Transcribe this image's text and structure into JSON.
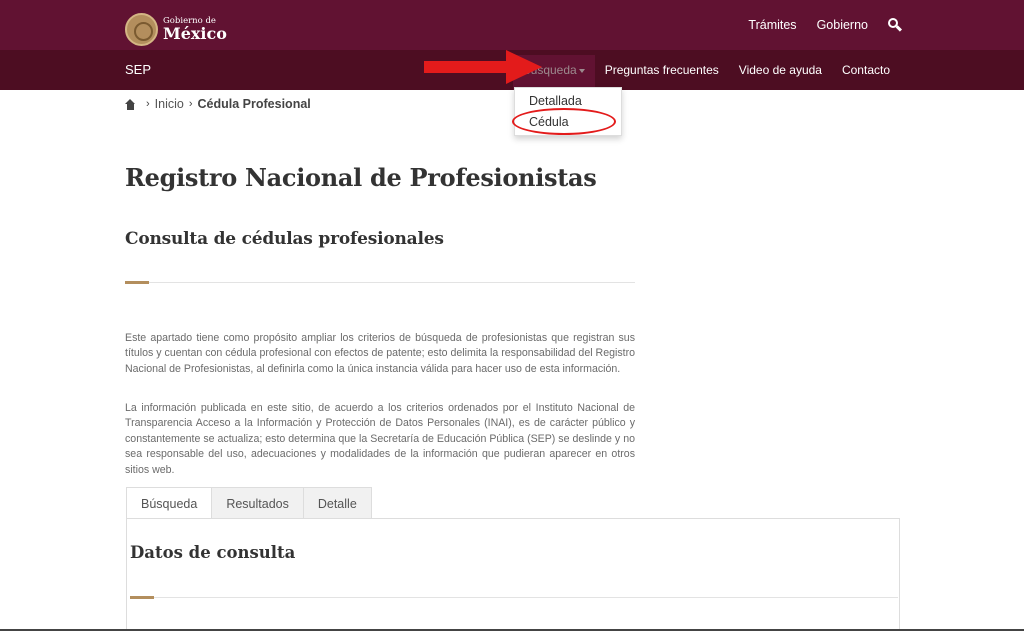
{
  "header": {
    "logo": {
      "line1": "Gobierno de",
      "line2": "México"
    },
    "links": [
      "Trámites",
      "Gobierno"
    ],
    "search_icon": "search-icon"
  },
  "nav": {
    "brand": "SEP",
    "items": [
      {
        "label": "Búsqueda"
      },
      {
        "label": "Preguntas frecuentes"
      },
      {
        "label": "Video de ayuda"
      },
      {
        "label": "Contacto"
      }
    ],
    "dropdown": [
      "Detallada",
      "Cédula"
    ]
  },
  "annotations": {
    "arrow_color": "#e31b1b",
    "circle_color": "#e31b1b"
  },
  "breadcrumb": {
    "home_icon": "home-icon",
    "inicio": "Inicio",
    "current": "Cédula Profesional"
  },
  "main": {
    "title": "Registro Nacional de Profesionistas",
    "subtitle": "Consulta de cédulas profesionales",
    "paragraphs": [
      "Este apartado tiene como propósito ampliar los criterios de búsqueda de profesionistas que registran sus títulos y cuentan con cédula profesional con efectos de patente; esto delimita la responsabilidad del Registro Nacional de Profesionistas, al definirla como la única instancia válida para hacer uso de esta información.",
      "La información publicada en este sitio, de acuerdo a los criterios ordenados por el Instituto Nacional de Transparencia Acceso a la Información y Protección de Datos Personales (INAI), es de carácter público y constantemente se actualiza; esto determina que la Secretaría de Educación Pública (SEP) se deslinde y no sea responsable del uso, adecuaciones y modalidades de la información que pudieran aparecer en otros sitios web."
    ],
    "tabs": [
      "Búsqueda",
      "Resultados",
      "Detalle"
    ],
    "panel_title": "Datos de consulta"
  },
  "colors": {
    "brand_primary": "#611232",
    "brand_dark": "#4d0d22",
    "accent_gold": "#b38e5d"
  }
}
